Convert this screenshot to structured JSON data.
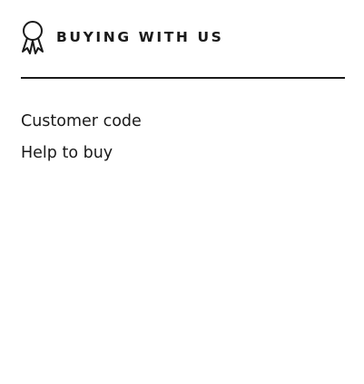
{
  "section": {
    "icon": "award-ribbon-icon",
    "title": "BUYING WITH US",
    "links": [
      {
        "label": "Customer code"
      },
      {
        "label": "Help to buy"
      }
    ]
  },
  "colors": {
    "text": "#1a1a1a",
    "background": "#ffffff",
    "divider": "#1a1a1a"
  }
}
